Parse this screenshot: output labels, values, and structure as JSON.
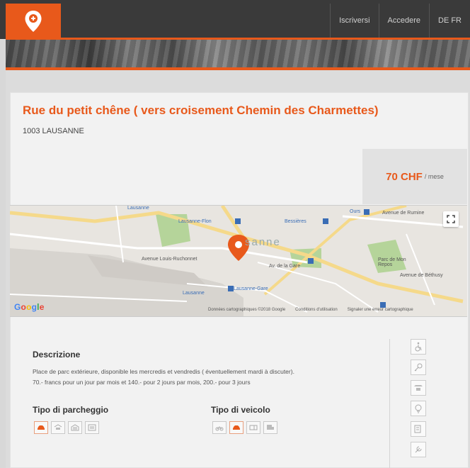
{
  "nav": {
    "items": [
      "Iscriversi",
      "Accedere",
      "DE FR"
    ]
  },
  "listing": {
    "title": "Rue du petit chêne ( vers croisement Chemin des Charmettes)",
    "city": "1003 LAUSANNE",
    "price": "70 CHF",
    "price_unit": "/ mese"
  },
  "map": {
    "labels": {
      "lausanne_flon": "Lausanne-Flon",
      "bessieres": "Bessières",
      "ours": "Ours",
      "lausanne_gare": "Lausanne-Gare",
      "lausanne_big": "sanne",
      "parc": "Parc de Mon Repos",
      "avenue_ruchonnet": "Avenue Louis-Ruchonnet",
      "avenue_gare": "Av. de la Gare",
      "lausanne_left": "Lausanne",
      "avenue_rumine": "Avenue de Rumine",
      "avenue_beaulieu": "Avenue de Béthusy"
    },
    "footer": [
      "Données cartographiques ©2018 Google",
      "Conditions d'utilisation",
      "Signaler une erreur cartographique"
    ],
    "google": [
      "G",
      "o",
      "o",
      "g",
      "l",
      "e"
    ]
  },
  "description": {
    "title": "Descrizione",
    "line1": "Place de parc extérieure, disponible les mercredis et vendredis ( éventuellement mardi à discuter).",
    "line2": "70.- francs pour un jour par mois et 140.- pour 2 jours par mois, 200.- pour 3 jours"
  },
  "parking": {
    "title": "Tipo di parcheggio"
  },
  "vehicle": {
    "title": "Tipo di veicolo"
  },
  "colors": {
    "accent": "#e8591b",
    "topbar": "#3a3a3a"
  }
}
